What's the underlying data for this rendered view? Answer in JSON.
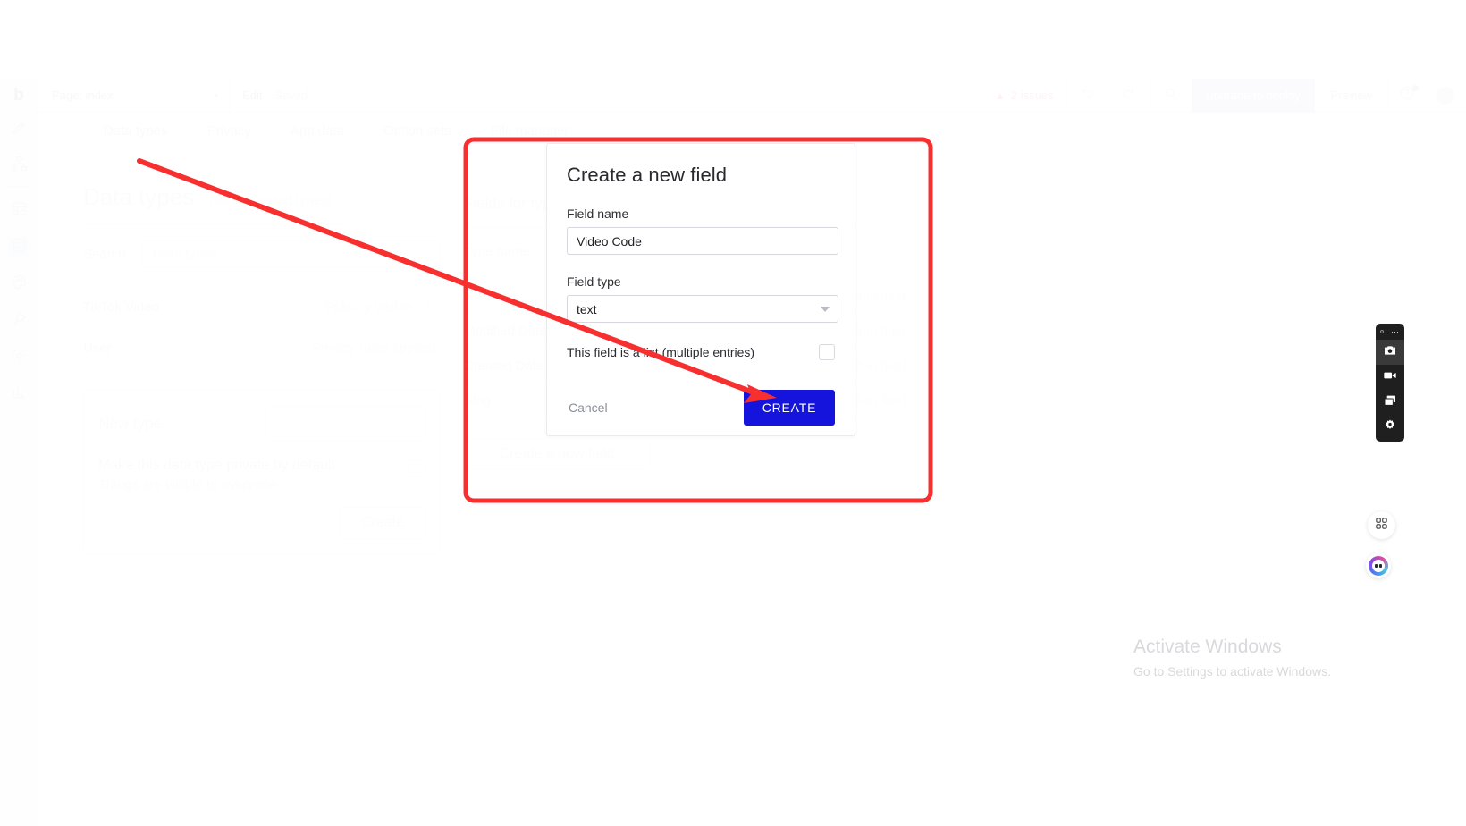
{
  "app": {
    "logo": "b"
  },
  "topbar": {
    "page_selector": "Page: index",
    "edit": "Edit",
    "saved": "Saved",
    "issues": "2 issues",
    "warning_icon": "warning-triangle-icon",
    "undo_icon": "undo-icon",
    "redo_icon": "redo-icon",
    "search_icon": "search-icon",
    "deploy_button": "Upgrade to deploy",
    "preview": "Preview",
    "help_icon": "help-circle-icon",
    "avatar": "user-avatar"
  },
  "rail": {
    "items": [
      {
        "name": "design",
        "icon": "pencil-icon"
      },
      {
        "name": "workflow",
        "icon": "sitemap-icon"
      },
      {
        "name": "backend",
        "icon": "backend-workflow-icon"
      },
      {
        "name": "data",
        "icon": "database-icon",
        "active": true
      },
      {
        "name": "styles",
        "icon": "palette-icon"
      },
      {
        "name": "plugins",
        "icon": "plug-icon"
      },
      {
        "name": "settings",
        "icon": "gear-icon"
      },
      {
        "name": "logs",
        "icon": "bar-chart-icon"
      }
    ]
  },
  "tabs": [
    {
      "label": "Data types",
      "active": true
    },
    {
      "label": "Privacy",
      "active": false
    },
    {
      "label": "App data",
      "active": false
    },
    {
      "label": "Option sets",
      "active": false
    },
    {
      "label": "File manager",
      "active": false
    }
  ],
  "data_types_panel": {
    "title": "Data types",
    "show_deleted": "(show deleted types)",
    "search_label": "Search",
    "search_placeholder": "Data types",
    "rows": [
      {
        "name": "TikTok Video",
        "status": "Publicly visible",
        "delete_icon": "trash-icon"
      },
      {
        "name": "User",
        "status": "Privacy rules applied",
        "delete_icon": ""
      }
    ],
    "new_type": {
      "label": "New type",
      "input_value": "",
      "private_label": "Make this data type private by default",
      "private_sub": "Things are visible to everyone",
      "create_button": "Create"
    }
  },
  "fields_panel": {
    "title": "Fields for type TikTok Video",
    "type_name_label": "Type name",
    "rows": [
      {
        "name": "Creator",
        "meta": "built-in field"
      },
      {
        "name": "Modified Date",
        "meta": "built-in field"
      },
      {
        "name": "Created Date",
        "meta": "built-in field"
      },
      {
        "name": "Slug",
        "meta": "built-in field"
      }
    ],
    "create_new_field_button": "Create a new field"
  },
  "modal": {
    "title": "Create a new field",
    "field_name_label": "Field name",
    "field_name_value": "Video Code",
    "field_type_label": "Field type",
    "field_type_value": "text",
    "field_type_caret": "chevron-down-icon",
    "list_checkbox_label": "This field is a list (multiple entries)",
    "list_checkbox_checked": false,
    "cancel_button": "Cancel",
    "create_button": "CREATE"
  },
  "screenshot_tool": {
    "menu_icon": "more-dots-icon",
    "record_dot_icon": "record-dot-icon",
    "buttons": [
      {
        "name": "camera-icon",
        "selected": true
      },
      {
        "name": "video-camera-icon",
        "selected": false
      },
      {
        "name": "window-capture-icon",
        "selected": false
      },
      {
        "name": "gear-icon",
        "selected": false
      }
    ]
  },
  "floating": {
    "apps_icon": "apps-grid-icon",
    "chat_icon": "assistant-avatar-icon"
  },
  "watermark": {
    "line1": "Activate Windows",
    "line2": "Go to Settings to activate Windows."
  },
  "annotation": {
    "highlight_color": "#f82f2f",
    "arrow_color": "#f82f2f",
    "highlight_target": "create-a-new-field-modal",
    "arrow_target": "create-button"
  },
  "colors": {
    "create_button": "#1414dd",
    "deploy_button_bg": "#e7e7fa",
    "annotation_red": "#f82f2f"
  }
}
